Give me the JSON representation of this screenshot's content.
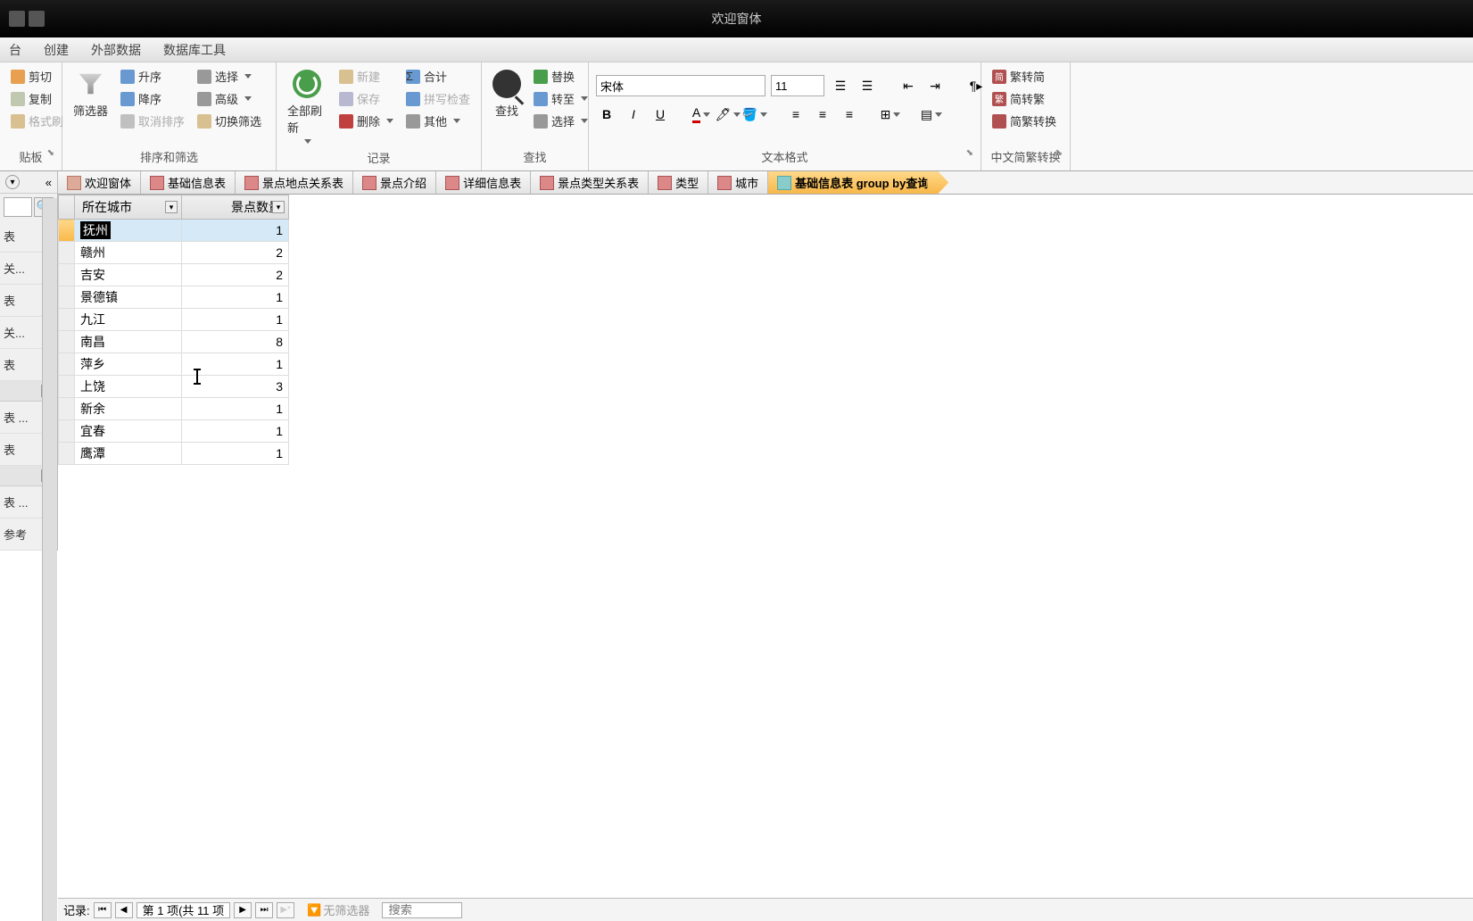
{
  "title": "欢迎窗体",
  "menubar": {
    "home": "台",
    "create": "创建",
    "external": "外部数据",
    "dbtools": "数据库工具"
  },
  "ribbon": {
    "clipboard": {
      "cut": "剪切",
      "copy": "复制",
      "paint": "格式刷",
      "label": "贴板"
    },
    "sort": {
      "asc": "升序",
      "desc": "降序",
      "clear": "取消排序",
      "filter": "筛选器",
      "select": "选择",
      "advanced": "高级",
      "toggle": "切换筛选",
      "label": "排序和筛选"
    },
    "records": {
      "refresh": "全部刷新",
      "new": "新建",
      "save": "保存",
      "delete": "删除",
      "sum": "合计",
      "spell": "拼写检查",
      "other": "其他",
      "label": "记录"
    },
    "find": {
      "find": "查找",
      "replace": "替换",
      "goto": "转至",
      "select": "选择",
      "label": "查找"
    },
    "font": {
      "name": "宋体",
      "size": "11",
      "label": "文本格式"
    },
    "chinese": {
      "t2s": "繁转简",
      "s2t": "简转繁",
      "convert": "简繁转换",
      "label": "中文简繁转换"
    }
  },
  "nav": {
    "items": [
      "表",
      "关...",
      "表",
      "关...",
      "表",
      "表 ...",
      "表",
      "表 ...",
      "参考"
    ],
    "collapse": "«"
  },
  "tabs": [
    {
      "label": "欢迎窗体",
      "type": "form"
    },
    {
      "label": "基础信息表",
      "type": "table"
    },
    {
      "label": "景点地点关系表",
      "type": "table"
    },
    {
      "label": "景点介绍",
      "type": "table"
    },
    {
      "label": "详细信息表",
      "type": "table"
    },
    {
      "label": "景点类型关系表",
      "type": "table"
    },
    {
      "label": "类型",
      "type": "table"
    },
    {
      "label": "城市",
      "type": "table"
    },
    {
      "label": "基础信息表 group by查询",
      "type": "query",
      "active": true
    }
  ],
  "columns": {
    "city": "所在城市",
    "count": "景点数量"
  },
  "rows": [
    {
      "city": "抚州",
      "count": 1,
      "current": true
    },
    {
      "city": "赣州",
      "count": 2
    },
    {
      "city": "吉安",
      "count": 2
    },
    {
      "city": "景德镇",
      "count": 1
    },
    {
      "city": "九江",
      "count": 1
    },
    {
      "city": "南昌",
      "count": 8
    },
    {
      "city": "萍乡",
      "count": 1
    },
    {
      "city": "上饶",
      "count": 3
    },
    {
      "city": "新余",
      "count": 1
    },
    {
      "city": "宜春",
      "count": 1
    },
    {
      "city": "鹰潭",
      "count": 1
    }
  ],
  "recordnav": {
    "label": "记录:",
    "pos": "第 1 项(共 11 项",
    "nofilter": "无筛选器",
    "search": "搜索"
  }
}
